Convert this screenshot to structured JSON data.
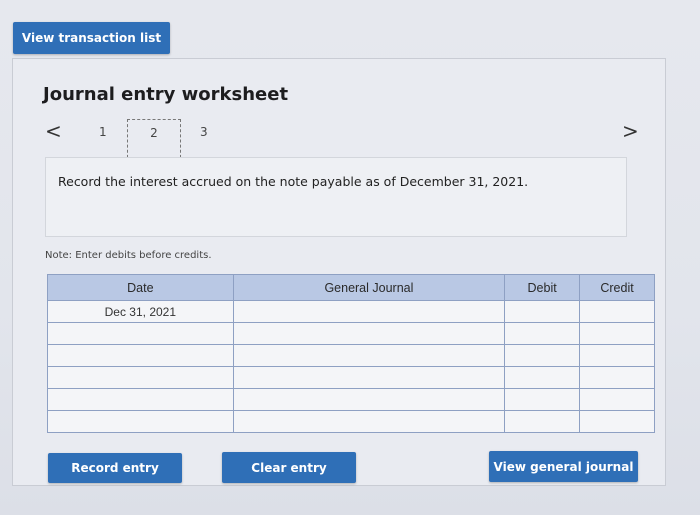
{
  "top_button": "View transaction list",
  "worksheet": {
    "title": "Journal entry worksheet",
    "pages": [
      "1",
      "2",
      "3"
    ],
    "current_page": "2",
    "prev_icon": "chevron-left-icon",
    "next_icon": "chevron-right-icon"
  },
  "instruction": "Record the interest accrued on the note payable as of December 31, 2021.",
  "note": "Note: Enter debits before credits.",
  "table": {
    "headers": {
      "date": "Date",
      "general_journal": "General Journal",
      "debit": "Debit",
      "credit": "Credit"
    },
    "rows": [
      {
        "date": "Dec 31, 2021",
        "general_journal": "",
        "debit": "",
        "credit": ""
      },
      {
        "date": "",
        "general_journal": "",
        "debit": "",
        "credit": ""
      },
      {
        "date": "",
        "general_journal": "",
        "debit": "",
        "credit": ""
      },
      {
        "date": "",
        "general_journal": "",
        "debit": "",
        "credit": ""
      },
      {
        "date": "",
        "general_journal": "",
        "debit": "",
        "credit": ""
      },
      {
        "date": "",
        "general_journal": "",
        "debit": "",
        "credit": ""
      }
    ]
  },
  "buttons": {
    "record": "Record entry",
    "clear": "Clear entry",
    "view_general_journal": "View general journal"
  },
  "colors": {
    "button": "#2f6fb7",
    "header_bg": "#b9c8e4",
    "input_accent": "#3d6fb5"
  }
}
